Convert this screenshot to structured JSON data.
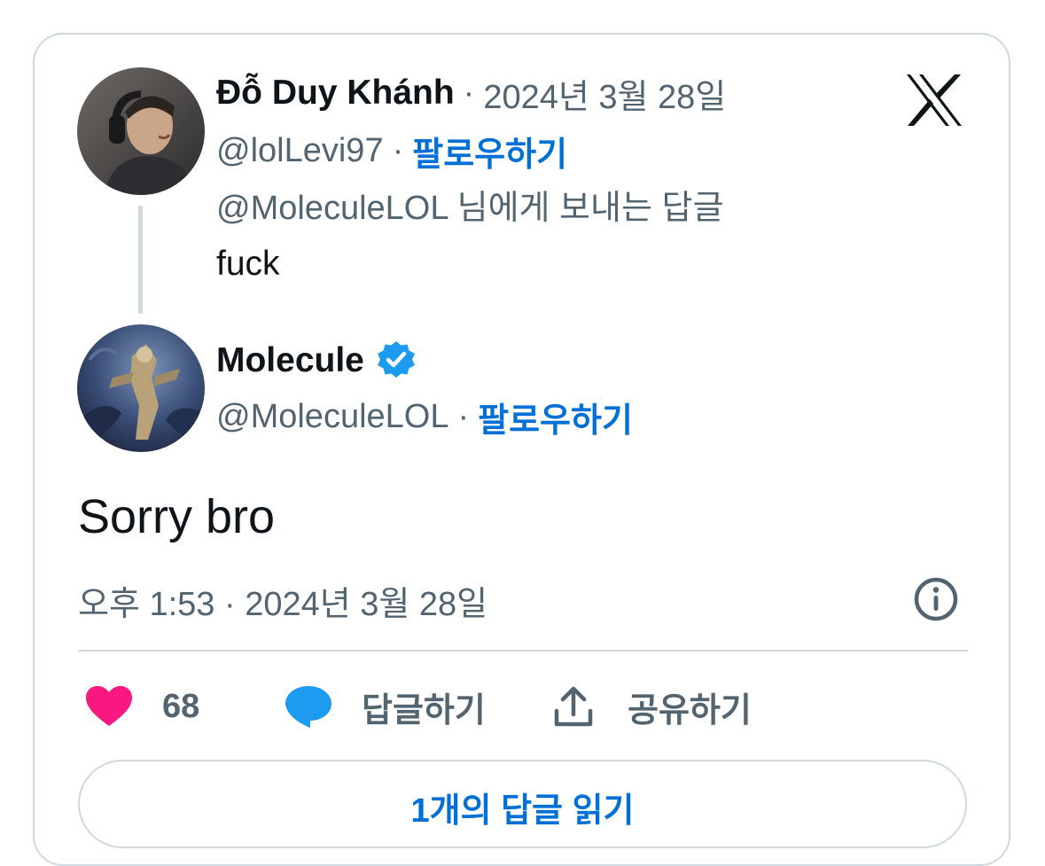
{
  "parent_tweet": {
    "author_name": "Đỗ Duy Khánh",
    "separator": "·",
    "date": "2024년 3월 28일",
    "handle": "@lolLevi97",
    "follow_label": "팔로우하기",
    "replying_to": "@MoleculeLOL 님에게 보내는 답글",
    "text": "fuck"
  },
  "main_tweet": {
    "author_name": "Molecule",
    "verified": true,
    "handle": "@MoleculeLOL",
    "separator": "·",
    "follow_label": "팔로우하기",
    "text": "Sorry bro",
    "timestamp": "오후 1:53 · 2024년 3월 28일"
  },
  "actions": {
    "like_count": "68",
    "reply_label": "답글하기",
    "share_label": "공유하기"
  },
  "read_replies_label": "1개의 답글 읽기",
  "icons": {
    "logo": "x-logo-icon",
    "verified": "verified-badge-icon",
    "info": "info-icon",
    "like": "heart-icon",
    "reply": "speech-bubble-icon",
    "share": "share-upload-icon"
  },
  "colors": {
    "link_blue": "#006fd6",
    "verified_blue": "#1d9bf0",
    "heart_pink": "#f91880",
    "text_primary": "#0f1419",
    "text_secondary": "#536471",
    "border": "#cfd9de"
  }
}
